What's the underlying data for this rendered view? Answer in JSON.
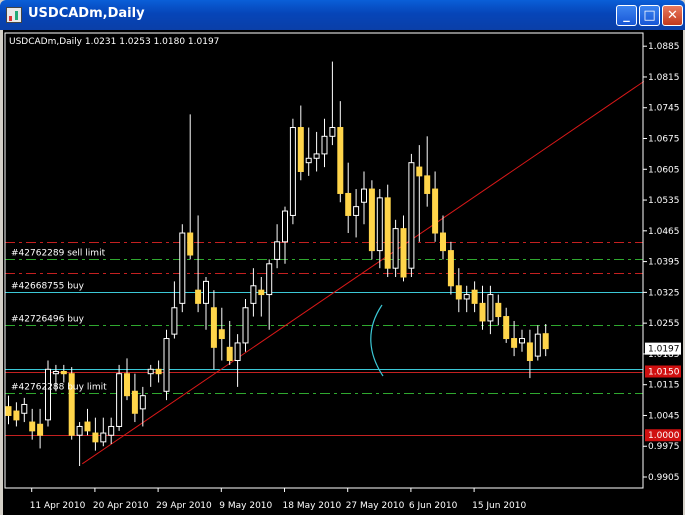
{
  "window": {
    "title": "USDCADm,Daily",
    "minimize_glyph": "_",
    "maximize_glyph": "□",
    "close_glyph": "✕",
    "app_icon": "chart-icon"
  },
  "chart_data": {
    "type": "candlestick",
    "symbol": "USDCADm",
    "timeframe": "Daily",
    "info_line": "USDCADm,Daily  1.0231 1.0253 1.0180 1.0197",
    "ohlc": [
      "1.0231",
      "1.0253",
      "1.0180",
      "1.0197"
    ],
    "colors": {
      "background": "#000000",
      "bull": "#ffffff",
      "bear": "#ffd54a",
      "foreground": "#ffffff"
    },
    "y_axis": {
      "min": 0.988,
      "max": 1.0915,
      "ticks": [
        "1.0885",
        "1.0815",
        "1.0745",
        "1.0675",
        "1.0605",
        "1.0535",
        "1.0465",
        "1.0395",
        "1.0325",
        "1.0255",
        "1.0185",
        "1.0115",
        "1.0045",
        "0.9975",
        "0.9905"
      ],
      "tick_values": [
        1.0885,
        1.0815,
        1.0745,
        1.0675,
        1.0605,
        1.0535,
        1.0465,
        1.0395,
        1.0325,
        1.0255,
        1.0185,
        1.0115,
        1.0045,
        0.9975,
        0.9905
      ]
    },
    "x_axis": {
      "labels": [
        {
          "text": "11 Apr 2010",
          "bar": 3
        },
        {
          "text": "20 Apr 2010",
          "bar": 11
        },
        {
          "text": "29 Apr 2010",
          "bar": 19
        },
        {
          "text": "9 May 2010",
          "bar": 27
        },
        {
          "text": "18 May 2010",
          "bar": 35
        },
        {
          "text": "27 May 2010",
          "bar": 43
        },
        {
          "text": "6 Jun 2010",
          "bar": 51
        },
        {
          "text": "15 Jun 2010",
          "bar": 59
        }
      ]
    },
    "current_price": {
      "label": "1.0197",
      "value": 1.0197,
      "color": "#ffffff"
    },
    "price_lines": [
      {
        "value": 1.044,
        "color": "#c42020",
        "style": "dashdot",
        "label": ""
      },
      {
        "value": 1.04,
        "color": "#2fa82f",
        "style": "dashdot",
        "label": "#42762289 sell limit"
      },
      {
        "value": 1.037,
        "color": "#c42020",
        "style": "dashdot",
        "label": ""
      },
      {
        "value": 1.0325,
        "color": "#3cc8d6",
        "style": "solid",
        "label": "#42668755 buy"
      },
      {
        "value": 1.025,
        "color": "#2fa82f",
        "style": "dashdot",
        "label": "#42726496 buy"
      },
      {
        "value": 1.015,
        "color": "#3cc8d6",
        "style": "solid",
        "label": ""
      },
      {
        "value": 1.0145,
        "color": "#c42020",
        "style": "solid",
        "label": ""
      },
      {
        "value": 1.0095,
        "color": "#2fa82f",
        "style": "dashdot",
        "label": "#42762288 buy limit"
      },
      {
        "value": 1.0,
        "color": "#c42020",
        "style": "solid",
        "label": ""
      }
    ],
    "axis_markers": [
      {
        "label": "1.0150",
        "value": 1.0145,
        "color": "#d01010"
      },
      {
        "label": "1.0000",
        "value": 1.0,
        "color": "#d01010"
      }
    ],
    "trendline": {
      "start": {
        "bar": 9.4,
        "price": 0.9935
      },
      "end": {
        "bar": 80.5,
        "price": 1.0805
      },
      "color": "#d81818"
    },
    "candles": [
      {
        "o": 1.0065,
        "h": 1.009,
        "l": 1.0025,
        "c": 1.0045
      },
      {
        "o": 1.0055,
        "h": 1.0075,
        "l": 1.002,
        "c": 1.0035
      },
      {
        "o": 1.005,
        "h": 1.0085,
        "l": 1.003,
        "c": 1.007
      },
      {
        "o": 1.003,
        "h": 1.006,
        "l": 0.999,
        "c": 1.001
      },
      {
        "o": 1.0025,
        "h": 1.006,
        "l": 0.997,
        "c": 1.0
      },
      {
        "o": 1.0035,
        "h": 1.017,
        "l": 1.002,
        "c": 1.015
      },
      {
        "o": 1.014,
        "h": 1.016,
        "l": 1.01,
        "c": 1.0145
      },
      {
        "o": 1.0145,
        "h": 1.016,
        "l": 1.012,
        "c": 1.014
      },
      {
        "o": 1.014,
        "h": 1.0155,
        "l": 0.999,
        "c": 1.0
      },
      {
        "o": 1.0,
        "h": 1.003,
        "l": 0.993,
        "c": 1.002
      },
      {
        "o": 1.003,
        "h": 1.006,
        "l": 1.0,
        "c": 1.001
      },
      {
        "o": 1.0005,
        "h": 1.004,
        "l": 0.9965,
        "c": 0.9985
      },
      {
        "o": 0.9985,
        "h": 1.004,
        "l": 0.9975,
        "c": 1.0005
      },
      {
        "o": 1.0,
        "h": 1.004,
        "l": 0.998,
        "c": 1.002
      },
      {
        "o": 1.002,
        "h": 1.016,
        "l": 1.001,
        "c": 1.014
      },
      {
        "o": 1.014,
        "h": 1.0175,
        "l": 1.008,
        "c": 1.009
      },
      {
        "o": 1.01,
        "h": 1.014,
        "l": 1.003,
        "c": 1.005
      },
      {
        "o": 1.006,
        "h": 1.011,
        "l": 1.002,
        "c": 1.009
      },
      {
        "o": 1.014,
        "h": 1.016,
        "l": 1.011,
        "c": 1.015
      },
      {
        "o": 1.015,
        "h": 1.017,
        "l": 1.012,
        "c": 1.014
      },
      {
        "o": 1.01,
        "h": 1.024,
        "l": 1.008,
        "c": 1.022
      },
      {
        "o": 1.023,
        "h": 1.035,
        "l": 1.022,
        "c": 1.029
      },
      {
        "o": 1.03,
        "h": 1.048,
        "l": 1.028,
        "c": 1.046
      },
      {
        "o": 1.046,
        "h": 1.073,
        "l": 1.04,
        "c": 1.041
      },
      {
        "o": 1.033,
        "h": 1.05,
        "l": 1.028,
        "c": 1.03
      },
      {
        "o": 1.03,
        "h": 1.036,
        "l": 1.024,
        "c": 1.035
      },
      {
        "o": 1.029,
        "h": 1.033,
        "l": 1.015,
        "c": 1.02
      },
      {
        "o": 1.024,
        "h": 1.029,
        "l": 1.017,
        "c": 1.022
      },
      {
        "o": 1.02,
        "h": 1.026,
        "l": 1.016,
        "c": 1.017
      },
      {
        "o": 1.017,
        "h": 1.023,
        "l": 1.011,
        "c": 1.021
      },
      {
        "o": 1.021,
        "h": 1.031,
        "l": 1.019,
        "c": 1.029
      },
      {
        "o": 1.03,
        "h": 1.038,
        "l": 1.027,
        "c": 1.034
      },
      {
        "o": 1.033,
        "h": 1.036,
        "l": 1.027,
        "c": 1.032
      },
      {
        "o": 1.032,
        "h": 1.04,
        "l": 1.024,
        "c": 1.039
      },
      {
        "o": 1.04,
        "h": 1.048,
        "l": 1.038,
        "c": 1.044
      },
      {
        "o": 1.044,
        "h": 1.052,
        "l": 1.039,
        "c": 1.051
      },
      {
        "o": 1.05,
        "h": 1.072,
        "l": 1.048,
        "c": 1.07
      },
      {
        "o": 1.07,
        "h": 1.075,
        "l": 1.058,
        "c": 1.06
      },
      {
        "o": 1.062,
        "h": 1.07,
        "l": 1.059,
        "c": 1.063
      },
      {
        "o": 1.063,
        "h": 1.069,
        "l": 1.06,
        "c": 1.064
      },
      {
        "o": 1.064,
        "h": 1.072,
        "l": 1.061,
        "c": 1.068
      },
      {
        "o": 1.068,
        "h": 1.085,
        "l": 1.066,
        "c": 1.07
      },
      {
        "o": 1.07,
        "h": 1.076,
        "l": 1.053,
        "c": 1.055
      },
      {
        "o": 1.055,
        "h": 1.062,
        "l": 1.046,
        "c": 1.05
      },
      {
        "o": 1.05,
        "h": 1.056,
        "l": 1.045,
        "c": 1.052
      },
      {
        "o": 1.053,
        "h": 1.06,
        "l": 1.048,
        "c": 1.056
      },
      {
        "o": 1.056,
        "h": 1.058,
        "l": 1.04,
        "c": 1.042
      },
      {
        "o": 1.042,
        "h": 1.056,
        "l": 1.038,
        "c": 1.054
      },
      {
        "o": 1.054,
        "h": 1.057,
        "l": 1.036,
        "c": 1.038
      },
      {
        "o": 1.038,
        "h": 1.049,
        "l": 1.036,
        "c": 1.047
      },
      {
        "o": 1.047,
        "h": 1.05,
        "l": 1.035,
        "c": 1.036
      },
      {
        "o": 1.038,
        "h": 1.064,
        "l": 1.036,
        "c": 1.062
      },
      {
        "o": 1.061,
        "h": 1.066,
        "l": 1.044,
        "c": 1.059
      },
      {
        "o": 1.059,
        "h": 1.068,
        "l": 1.052,
        "c": 1.055
      },
      {
        "o": 1.056,
        "h": 1.06,
        "l": 1.044,
        "c": 1.046
      },
      {
        "o": 1.046,
        "h": 1.05,
        "l": 1.04,
        "c": 1.042
      },
      {
        "o": 1.042,
        "h": 1.044,
        "l": 1.032,
        "c": 1.034
      },
      {
        "o": 1.034,
        "h": 1.038,
        "l": 1.028,
        "c": 1.031
      },
      {
        "o": 1.031,
        "h": 1.034,
        "l": 1.028,
        "c": 1.032
      },
      {
        "o": 1.033,
        "h": 1.035,
        "l": 1.028,
        "c": 1.03
      },
      {
        "o": 1.03,
        "h": 1.034,
        "l": 1.024,
        "c": 1.026
      },
      {
        "o": 1.026,
        "h": 1.034,
        "l": 1.023,
        "c": 1.032
      },
      {
        "o": 1.03,
        "h": 1.032,
        "l": 1.025,
        "c": 1.027
      },
      {
        "o": 1.027,
        "h": 1.029,
        "l": 1.021,
        "c": 1.022
      },
      {
        "o": 1.022,
        "h": 1.026,
        "l": 1.018,
        "c": 1.02
      },
      {
        "o": 1.021,
        "h": 1.024,
        "l": 1.019,
        "c": 1.022
      },
      {
        "o": 1.021,
        "h": 1.024,
        "l": 1.013,
        "c": 1.017
      },
      {
        "o": 1.018,
        "h": 1.025,
        "l": 1.017,
        "c": 1.023
      },
      {
        "o": 1.0231,
        "h": 1.0253,
        "l": 1.018,
        "c": 1.0197
      }
    ]
  }
}
